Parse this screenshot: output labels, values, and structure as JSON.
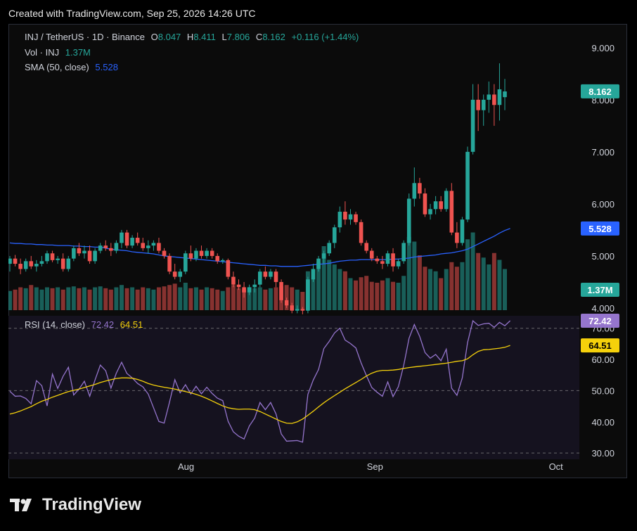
{
  "caption": "Created with TradingView.com, Sep 25, 2026 14:26 UTC",
  "brand": "TradingView",
  "legend": {
    "symbol": "INJ / TetherUS · 1D · Binance",
    "o_label": "O",
    "o_value": "8.047",
    "h_label": "H",
    "h_value": "8.411",
    "l_label": "L",
    "l_value": "7.806",
    "c_label": "C",
    "c_value": "8.162",
    "change": "+0.116 (+1.44%)",
    "vol_label": "Vol · INJ",
    "vol_value": "1.37M",
    "sma_label": "SMA (50, close)",
    "sma_value": "5.528",
    "rsi_label": "RSI (14, close)",
    "rsi_value": "72.42",
    "rsi_ma_value": "64.51"
  },
  "colors": {
    "up": "#26a69a",
    "down": "#ef5350",
    "sma": "#2962ff",
    "rsi": "#9575cd",
    "rsi_ma": "#f5d10b"
  },
  "chart_data": [
    {
      "type": "candlestick",
      "title": "INJ / TetherUS · 1D · Binance",
      "y_ticks": [
        "9.000",
        "8.000",
        "7.000",
        "6.000",
        "5.000",
        "4.000"
      ],
      "ylim": [
        3.5,
        9.2
      ],
      "x_ticks": [
        "Aug",
        "Sep",
        "Oct"
      ],
      "price_badges": {
        "last": "8.162",
        "sma": "5.528",
        "volume": "1.37M"
      },
      "candles_ohlc": [
        [
          4.85,
          5.0,
          4.7,
          4.95
        ],
        [
          4.95,
          5.02,
          4.8,
          4.85
        ],
        [
          4.85,
          4.95,
          4.65,
          4.75
        ],
        [
          4.75,
          4.95,
          4.7,
          4.9
        ],
        [
          4.9,
          5.0,
          4.75,
          4.8
        ],
        [
          4.8,
          4.92,
          4.7,
          4.85
        ],
        [
          4.85,
          5.0,
          4.8,
          4.9
        ],
        [
          4.9,
          5.1,
          4.85,
          5.05
        ],
        [
          5.05,
          5.1,
          4.88,
          4.92
        ],
        [
          4.92,
          5.0,
          4.85,
          4.95
        ],
        [
          4.95,
          5.05,
          4.7,
          4.75
        ],
        [
          4.75,
          5.0,
          4.7,
          4.95
        ],
        [
          4.95,
          5.2,
          4.9,
          5.15
        ],
        [
          5.15,
          5.25,
          5.0,
          5.05
        ],
        [
          5.05,
          5.2,
          4.95,
          5.1
        ],
        [
          5.1,
          5.2,
          4.85,
          4.9
        ],
        [
          4.9,
          5.15,
          4.85,
          5.1
        ],
        [
          5.1,
          5.25,
          5.05,
          5.2
        ],
        [
          5.2,
          5.3,
          5.1,
          5.15
        ],
        [
          5.15,
          5.25,
          5.0,
          5.1
        ],
        [
          5.1,
          5.3,
          5.05,
          5.25
        ],
        [
          5.25,
          5.5,
          5.15,
          5.45
        ],
        [
          5.45,
          5.5,
          5.15,
          5.2
        ],
        [
          5.2,
          5.4,
          5.15,
          5.35
        ],
        [
          5.35,
          5.45,
          5.2,
          5.25
        ],
        [
          5.25,
          5.35,
          5.1,
          5.15
        ],
        [
          5.15,
          5.3,
          5.05,
          5.2
        ],
        [
          5.2,
          5.3,
          5.1,
          5.25
        ],
        [
          5.25,
          5.35,
          5.05,
          5.1
        ],
        [
          5.1,
          5.15,
          4.95,
          5.0
        ],
        [
          5.0,
          5.05,
          4.65,
          4.7
        ],
        [
          4.7,
          4.85,
          4.55,
          4.6
        ],
        [
          4.6,
          4.75,
          4.5,
          4.7
        ],
        [
          4.7,
          5.1,
          4.65,
          5.05
        ],
        [
          5.05,
          5.2,
          4.9,
          4.95
        ],
        [
          4.95,
          5.15,
          4.9,
          5.1
        ],
        [
          5.1,
          5.2,
          4.95,
          5.0
        ],
        [
          5.0,
          5.15,
          4.95,
          5.1
        ],
        [
          5.1,
          5.15,
          4.95,
          5.0
        ],
        [
          5.0,
          5.05,
          4.85,
          4.9
        ],
        [
          4.9,
          4.95,
          4.85,
          4.92
        ],
        [
          4.92,
          4.95,
          4.55,
          4.6
        ],
        [
          4.6,
          4.7,
          4.4,
          4.45
        ],
        [
          4.45,
          4.55,
          4.35,
          4.4
        ],
        [
          4.4,
          4.5,
          4.2,
          4.3
        ],
        [
          4.3,
          4.45,
          4.25,
          4.4
        ],
        [
          4.4,
          4.55,
          4.3,
          4.45
        ],
        [
          4.45,
          4.75,
          4.4,
          4.7
        ],
        [
          4.7,
          4.8,
          4.55,
          4.6
        ],
        [
          4.6,
          4.75,
          4.55,
          4.7
        ],
        [
          4.7,
          4.75,
          4.4,
          4.5
        ],
        [
          4.5,
          4.55,
          4.1,
          4.15
        ],
        [
          4.15,
          4.2,
          4.0,
          4.05
        ],
        [
          4.05,
          4.1,
          3.9,
          3.95
        ],
        [
          3.95,
          4.05,
          3.9,
          3.98
        ],
        [
          3.98,
          4.02,
          3.88,
          3.95
        ],
        [
          3.95,
          4.6,
          3.9,
          4.55
        ],
        [
          4.55,
          4.85,
          4.5,
          4.75
        ],
        [
          4.75,
          5.0,
          4.7,
          4.95
        ],
        [
          4.95,
          5.1,
          4.85,
          5.05
        ],
        [
          5.05,
          5.3,
          5.0,
          5.25
        ],
        [
          5.25,
          5.6,
          5.15,
          5.55
        ],
        [
          5.55,
          5.95,
          5.45,
          5.85
        ],
        [
          5.85,
          6.05,
          5.6,
          5.7
        ],
        [
          5.7,
          5.9,
          5.6,
          5.8
        ],
        [
          5.8,
          5.85,
          5.6,
          5.65
        ],
        [
          5.65,
          5.7,
          5.2,
          5.25
        ],
        [
          5.25,
          5.3,
          5.05,
          5.1
        ],
        [
          5.1,
          5.15,
          4.9,
          4.95
        ],
        [
          4.95,
          5.0,
          4.85,
          4.9
        ],
        [
          4.9,
          5.0,
          4.75,
          4.85
        ],
        [
          4.85,
          5.1,
          4.8,
          5.05
        ],
        [
          5.05,
          5.15,
          4.7,
          4.8
        ],
        [
          4.8,
          4.95,
          4.75,
          4.9
        ],
        [
          4.9,
          5.3,
          4.85,
          5.25
        ],
        [
          5.25,
          6.2,
          5.2,
          6.1
        ],
        [
          6.1,
          6.7,
          5.95,
          6.4
        ],
        [
          6.4,
          6.5,
          6.1,
          6.2
        ],
        [
          6.2,
          6.3,
          5.75,
          5.8
        ],
        [
          5.8,
          6.0,
          5.7,
          5.9
        ],
        [
          5.9,
          6.15,
          5.8,
          6.05
        ],
        [
          6.05,
          6.15,
          5.85,
          5.9
        ],
        [
          5.9,
          6.3,
          5.85,
          6.25
        ],
        [
          6.25,
          6.4,
          5.4,
          5.45
        ],
        [
          5.45,
          5.65,
          5.15,
          5.25
        ],
        [
          5.25,
          5.75,
          5.2,
          5.7
        ],
        [
          5.7,
          7.1,
          5.65,
          7.0
        ],
        [
          7.0,
          8.3,
          6.95,
          8.0
        ],
        [
          8.0,
          8.3,
          7.4,
          7.8
        ],
        [
          7.8,
          8.1,
          7.5,
          8.0
        ],
        [
          8.0,
          8.35,
          7.75,
          8.1
        ],
        [
          8.1,
          8.3,
          7.5,
          7.9
        ],
        [
          7.9,
          8.7,
          7.6,
          8.2
        ],
        [
          8.05,
          8.4,
          7.8,
          8.16
        ]
      ],
      "volume_ratio": [
        0.42,
        0.45,
        0.5,
        0.48,
        0.55,
        0.5,
        0.45,
        0.5,
        0.48,
        0.5,
        0.45,
        0.5,
        0.52,
        0.48,
        0.5,
        0.45,
        0.5,
        0.52,
        0.48,
        0.45,
        0.5,
        0.55,
        0.48,
        0.5,
        0.45,
        0.5,
        0.48,
        0.45,
        0.5,
        0.52,
        0.55,
        0.58,
        0.5,
        0.6,
        0.48,
        0.5,
        0.45,
        0.5,
        0.48,
        0.45,
        0.42,
        0.5,
        0.55,
        0.48,
        0.45,
        0.5,
        0.48,
        0.5,
        0.45,
        0.48,
        0.5,
        0.52,
        0.55,
        0.5,
        0.45,
        0.4,
        0.85,
        0.9,
        1.05,
        1.4,
        1.1,
        1.0,
        0.9,
        0.85,
        0.7,
        0.65,
        0.72,
        0.75,
        0.62,
        0.6,
        0.65,
        0.7,
        0.62,
        0.6,
        0.75,
        1.6,
        1.5,
        1.2,
        0.95,
        0.9,
        0.85,
        0.7,
        0.9,
        1.05,
        0.95,
        1.05,
        1.55,
        1.7,
        1.25,
        1.15,
        1.0,
        1.25,
        1.1,
        0.9,
        0.78
      ],
      "sma_50": [
        5.25,
        5.24,
        5.24,
        5.23,
        5.23,
        5.22,
        5.22,
        5.21,
        5.21,
        5.2,
        5.2,
        5.2,
        5.19,
        5.19,
        5.18,
        5.18,
        5.17,
        5.17,
        5.15,
        5.13,
        5.12,
        5.11,
        5.1,
        5.08,
        5.07,
        5.06,
        5.05,
        5.04,
        5.02,
        5.0,
        4.99,
        4.98,
        4.97,
        4.96,
        4.95,
        4.94,
        4.93,
        4.92,
        4.91,
        4.9,
        4.89,
        4.88,
        4.87,
        4.86,
        4.85,
        4.84,
        4.83,
        4.82,
        4.82,
        4.81,
        4.81,
        4.8,
        4.8,
        4.8,
        4.8,
        4.81,
        4.82,
        4.83,
        4.84,
        4.85,
        4.86,
        4.88,
        4.9,
        4.91,
        4.92,
        4.92,
        4.93,
        4.93,
        4.93,
        4.93,
        4.93,
        4.93,
        4.94,
        4.94,
        4.95,
        4.96,
        4.98,
        4.99,
        5.0,
        5.01,
        5.02,
        5.04,
        5.05,
        5.06,
        5.08,
        5.1,
        5.13,
        5.18,
        5.23,
        5.28,
        5.33,
        5.38,
        5.44,
        5.49,
        5.528
      ]
    },
    {
      "type": "line",
      "title": "RSI (14, close)",
      "y_ticks": [
        "70.00",
        "60.00",
        "50.00",
        "40.00",
        "30.00"
      ],
      "ylim": [
        28,
        74
      ],
      "bands": [
        70,
        50,
        30
      ],
      "series": [
        {
          "name": "RSI",
          "last": "72.42",
          "values": [
            49.8,
            48.2,
            48.3,
            47.5,
            45.8,
            53.2,
            51.6,
            45.1,
            55.3,
            50.7,
            54.6,
            57.5,
            48.6,
            50.5,
            53.0,
            48.2,
            53.4,
            58.2,
            56.4,
            50.8,
            55.6,
            59.1,
            55.5,
            54.1,
            52.3,
            51.2,
            48.9,
            44.5,
            40.1,
            39.6,
            46.3,
            53.5,
            49.3,
            51.9,
            48.9,
            51.4,
            49.0,
            51.1,
            49.1,
            47.6,
            46.8,
            40.2,
            36.8,
            35.4,
            34.5,
            38.7,
            41.2,
            46.2,
            43.9,
            46.2,
            42.6,
            36.1,
            33.8,
            33.9,
            34.0,
            33.5,
            48.8,
            53.4,
            56.8,
            63.5,
            65.8,
            68.5,
            70.0,
            66.2,
            65.1,
            63.7,
            58.9,
            54.8,
            51.0,
            49.5,
            48.2,
            52.8,
            48.1,
            51.3,
            58.1,
            66.8,
            71.2,
            67.4,
            62.2,
            60.4,
            61.6,
            59.6,
            63.3,
            50.8,
            48.5,
            54.1,
            65.4,
            72.4,
            70.9,
            71.4,
            71.6,
            70.3,
            71.9,
            70.8,
            72.42
          ]
        },
        {
          "name": "RSI MA",
          "last": "64.51",
          "values": [
            42.5,
            42.9,
            43.5,
            44.2,
            44.9,
            45.8,
            46.6,
            47.2,
            47.9,
            48.5,
            49.1,
            49.7,
            50.1,
            50.5,
            51.0,
            51.5,
            52.0,
            52.6,
            53.1,
            53.5,
            53.9,
            54.1,
            54.1,
            54.0,
            53.6,
            53.0,
            52.3,
            51.8,
            51.4,
            51.1,
            50.8,
            50.5,
            50.1,
            49.7,
            49.3,
            48.8,
            48.2,
            47.5,
            46.7,
            45.9,
            45.1,
            44.5,
            44.2,
            44.0,
            44.1,
            44.1,
            43.9,
            43.3,
            42.5,
            41.7,
            40.9,
            40.1,
            39.6,
            39.5,
            40.0,
            40.9,
            42.1,
            43.4,
            44.8,
            46.1,
            47.3,
            48.4,
            49.5,
            50.6,
            51.6,
            52.6,
            53.6,
            54.7,
            55.6,
            56.2,
            56.5,
            56.5,
            56.6,
            56.8,
            57.1,
            57.4,
            57.6,
            57.8,
            58.0,
            58.2,
            58.4,
            58.6,
            58.8,
            59.1,
            59.4,
            59.6,
            60.2,
            61.5,
            62.6,
            63.1,
            63.2,
            63.4,
            63.6,
            63.9,
            64.51
          ]
        }
      ]
    }
  ]
}
